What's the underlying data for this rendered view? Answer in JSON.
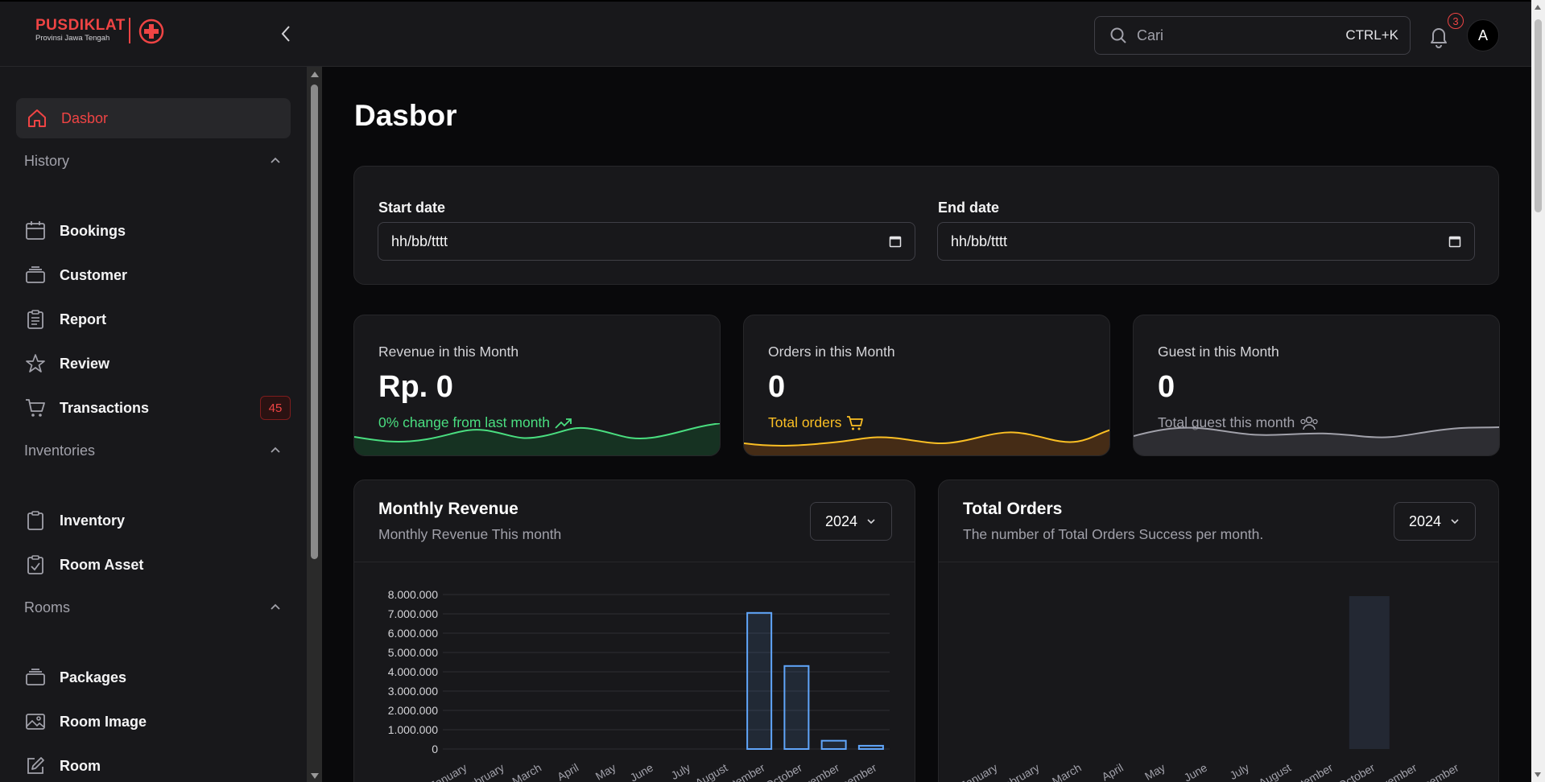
{
  "brand": {
    "title": "PUSDIKLAT",
    "subtitle": "Provinsi Jawa Tengah"
  },
  "header": {
    "search_placeholder": "Cari",
    "search_shortcut": "CTRL+K",
    "notification_count": "3",
    "avatar_initial": "A"
  },
  "sidebar": {
    "active": {
      "label": "Dasbor",
      "icon": "home-icon"
    },
    "groups": [
      {
        "title": "History",
        "items": [
          {
            "label": "Bookings",
            "icon": "calendar-icon"
          },
          {
            "label": "Customer",
            "icon": "stack-icon"
          },
          {
            "label": "Report",
            "icon": "clipboard-list-icon"
          },
          {
            "label": "Review",
            "icon": "star-icon"
          },
          {
            "label": "Transactions",
            "icon": "cart-icon",
            "badge": "45"
          }
        ]
      },
      {
        "title": "Inventories",
        "items": [
          {
            "label": "Inventory",
            "icon": "clipboard-icon"
          },
          {
            "label": "Room Asset",
            "icon": "clipboard-check-icon"
          }
        ]
      },
      {
        "title": "Rooms",
        "items": [
          {
            "label": "Packages",
            "icon": "stack-icon"
          },
          {
            "label": "Room Image",
            "icon": "image-icon"
          },
          {
            "label": "Room",
            "icon": "edit-icon"
          }
        ]
      }
    ]
  },
  "main": {
    "title": "Dasbor",
    "filters": {
      "start_label": "Start date",
      "start_value": "hh/bb/tttt",
      "end_label": "End date",
      "end_value": "hh/bb/tttt"
    },
    "stats": [
      {
        "title": "Revenue in this Month",
        "value": "Rp. 0",
        "sub": "0% change from last month",
        "color": "#4ade80",
        "icon": "trending-up-icon"
      },
      {
        "title": "Orders in this Month",
        "value": "0",
        "sub": "Total orders",
        "color": "#fbbf24",
        "icon": "cart-icon"
      },
      {
        "title": "Guest in this Month",
        "value": "0",
        "sub": "Total guest this month",
        "color": "#a1a1aa",
        "icon": "users-icon"
      }
    ],
    "revenue_chart": {
      "title": "Monthly Revenue",
      "subtitle": "Monthly Revenue This month",
      "year": "2024"
    },
    "orders_chart": {
      "title": "Total Orders",
      "subtitle": "The number of Total Orders Success per month.",
      "year": "2024"
    }
  },
  "chart_data": [
    {
      "type": "bar",
      "title": "Monthly Revenue",
      "categories": [
        "January",
        "February",
        "March",
        "April",
        "May",
        "June",
        "July",
        "August",
        "September",
        "October",
        "November",
        "December"
      ],
      "values": [
        0,
        0,
        0,
        0,
        0,
        0,
        0,
        0,
        7050000,
        4300000,
        430000,
        170000
      ],
      "ylim": [
        0,
        8000000
      ],
      "yticks": [
        "8.000.000",
        "7.000.000",
        "6.000.000",
        "5.000.000",
        "4.000.000",
        "3.000.000",
        "2.000.000",
        "1.000.000",
        "0"
      ],
      "grid": true,
      "color": "#60a5fa"
    },
    {
      "type": "bar",
      "title": "Total Orders",
      "categories": [
        "January",
        "February",
        "March",
        "April",
        "May",
        "June",
        "July",
        "August",
        "September",
        "October",
        "November",
        "December"
      ],
      "highlight_index": 9,
      "grid": false
    }
  ]
}
